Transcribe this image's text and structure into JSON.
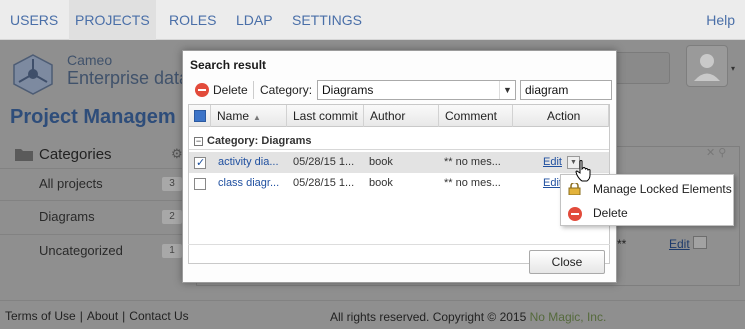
{
  "nav": {
    "tabs": [
      {
        "label": "USERS"
      },
      {
        "label": "PROJECTS"
      },
      {
        "label": "ROLES"
      },
      {
        "label": "LDAP"
      },
      {
        "label": "SETTINGS"
      }
    ],
    "help": "Help"
  },
  "brand": {
    "line1": "Cameo",
    "line2": "Enterprise data"
  },
  "page_title": "Project Managem",
  "sidebar": {
    "header": "Categories",
    "items": [
      {
        "label": "All projects",
        "count": "3"
      },
      {
        "label": "Diagrams",
        "count": "2"
      },
      {
        "label": "Uncategorized",
        "count": "1"
      }
    ]
  },
  "background_row": {
    "text": "**",
    "edit": "Edit"
  },
  "footer": {
    "terms": "Terms of Use",
    "about": "About",
    "contact": "Contact Us",
    "copyright": "All rights reserved. Copyright © 2015",
    "company": "No Magic, Inc."
  },
  "dialog": {
    "title": "Search result",
    "delete_label": "Delete",
    "category_label": "Category:",
    "category_value": "Diagrams",
    "search_value": "diagram",
    "columns": {
      "name": "Name",
      "last_commit": "Last commit",
      "author": "Author",
      "comment": "Comment",
      "action": "Action"
    },
    "group_label": "Category: Diagrams",
    "rows": [
      {
        "name": "activity dia...",
        "last_commit": "05/28/15 1...",
        "author": "book",
        "comment": "** no mes...",
        "action": "Edit",
        "checked": true
      },
      {
        "name": "class diagr...",
        "last_commit": "05/28/15 1...",
        "author": "book",
        "comment": "** no mes...",
        "action": "Edit",
        "checked": false
      }
    ],
    "close_label": "Close"
  },
  "context_menu": {
    "items": [
      {
        "label": "Manage Locked Elements",
        "icon": "lock-icon"
      },
      {
        "label": "Delete",
        "icon": "delete-icon"
      }
    ]
  }
}
